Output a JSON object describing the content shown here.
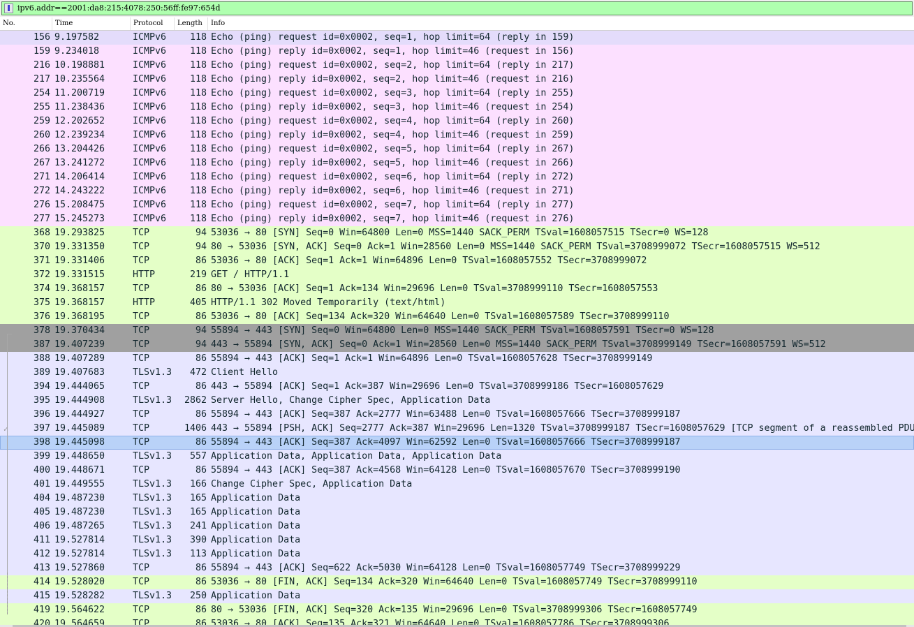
{
  "filter": {
    "value": "ipv6.addr==2001:da8:215:4078:250:56ff:fe97:654d"
  },
  "columns": {
    "no": "No.",
    "time": "Time",
    "protocol": "Protocol",
    "length": "Length",
    "info": "Info"
  },
  "colors": {
    "icmp": "#fce0ff",
    "icmp_first": "#e4dcfb",
    "tcp_http": "#e4ffc7",
    "tcp_syn": "#a0a0a0",
    "tcp_other": "#e7e6ff",
    "selected": "#b9d2f8"
  },
  "packets": [
    {
      "no": "156",
      "time": "9.197582",
      "proto": "ICMPv6",
      "len": "118",
      "info": "Echo (ping) request id=0x0002, seq=1, hop limit=64 (reply in 159)",
      "color": "icmp_first"
    },
    {
      "no": "159",
      "time": "9.234018",
      "proto": "ICMPv6",
      "len": "118",
      "info": "Echo (ping) reply id=0x0002, seq=1, hop limit=46 (request in 156)",
      "color": "icmp"
    },
    {
      "no": "216",
      "time": "10.198881",
      "proto": "ICMPv6",
      "len": "118",
      "info": "Echo (ping) request id=0x0002, seq=2, hop limit=64 (reply in 217)",
      "color": "icmp"
    },
    {
      "no": "217",
      "time": "10.235564",
      "proto": "ICMPv6",
      "len": "118",
      "info": "Echo (ping) reply id=0x0002, seq=2, hop limit=46 (request in 216)",
      "color": "icmp"
    },
    {
      "no": "254",
      "time": "11.200719",
      "proto": "ICMPv6",
      "len": "118",
      "info": "Echo (ping) request id=0x0002, seq=3, hop limit=64 (reply in 255)",
      "color": "icmp"
    },
    {
      "no": "255",
      "time": "11.238436",
      "proto": "ICMPv6",
      "len": "118",
      "info": "Echo (ping) reply id=0x0002, seq=3, hop limit=46 (request in 254)",
      "color": "icmp"
    },
    {
      "no": "259",
      "time": "12.202652",
      "proto": "ICMPv6",
      "len": "118",
      "info": "Echo (ping) request id=0x0002, seq=4, hop limit=64 (reply in 260)",
      "color": "icmp"
    },
    {
      "no": "260",
      "time": "12.239234",
      "proto": "ICMPv6",
      "len": "118",
      "info": "Echo (ping) reply id=0x0002, seq=4, hop limit=46 (request in 259)",
      "color": "icmp"
    },
    {
      "no": "266",
      "time": "13.204426",
      "proto": "ICMPv6",
      "len": "118",
      "info": "Echo (ping) request id=0x0002, seq=5, hop limit=64 (reply in 267)",
      "color": "icmp"
    },
    {
      "no": "267",
      "time": "13.241272",
      "proto": "ICMPv6",
      "len": "118",
      "info": "Echo (ping) reply id=0x0002, seq=5, hop limit=46 (request in 266)",
      "color": "icmp"
    },
    {
      "no": "271",
      "time": "14.206414",
      "proto": "ICMPv6",
      "len": "118",
      "info": "Echo (ping) request id=0x0002, seq=6, hop limit=64 (reply in 272)",
      "color": "icmp"
    },
    {
      "no": "272",
      "time": "14.243222",
      "proto": "ICMPv6",
      "len": "118",
      "info": "Echo (ping) reply id=0x0002, seq=6, hop limit=46 (request in 271)",
      "color": "icmp"
    },
    {
      "no": "276",
      "time": "15.208475",
      "proto": "ICMPv6",
      "len": "118",
      "info": "Echo (ping) request id=0x0002, seq=7, hop limit=64 (reply in 277)",
      "color": "icmp"
    },
    {
      "no": "277",
      "time": "15.245273",
      "proto": "ICMPv6",
      "len": "118",
      "info": "Echo (ping) reply id=0x0002, seq=7, hop limit=46 (request in 276)",
      "color": "icmp"
    },
    {
      "no": "368",
      "time": "19.293825",
      "proto": "TCP",
      "len": "94",
      "info": "53036 → 80 [SYN] Seq=0 Win=64800 Len=0 MSS=1440 SACK_PERM TSval=1608057515 TSecr=0 WS=128",
      "color": "tcp_http"
    },
    {
      "no": "370",
      "time": "19.331350",
      "proto": "TCP",
      "len": "94",
      "info": "80 → 53036 [SYN, ACK] Seq=0 Ack=1 Win=28560 Len=0 MSS=1440 SACK_PERM TSval=3708999072 TSecr=1608057515 WS=512",
      "color": "tcp_http"
    },
    {
      "no": "371",
      "time": "19.331406",
      "proto": "TCP",
      "len": "86",
      "info": "53036 → 80 [ACK] Seq=1 Ack=1 Win=64896 Len=0 TSval=1608057552 TSecr=3708999072",
      "color": "tcp_http"
    },
    {
      "no": "372",
      "time": "19.331515",
      "proto": "HTTP",
      "len": "219",
      "info": "GET / HTTP/1.1",
      "color": "tcp_http"
    },
    {
      "no": "374",
      "time": "19.368157",
      "proto": "TCP",
      "len": "86",
      "info": "80 → 53036 [ACK] Seq=1 Ack=134 Win=29696 Len=0 TSval=3708999110 TSecr=1608057553",
      "color": "tcp_http"
    },
    {
      "no": "375",
      "time": "19.368157",
      "proto": "HTTP",
      "len": "405",
      "info": "HTTP/1.1 302 Moved Temporarily  (text/html)",
      "color": "tcp_http"
    },
    {
      "no": "376",
      "time": "19.368195",
      "proto": "TCP",
      "len": "86",
      "info": "53036 → 80 [ACK] Seq=134 Ack=320 Win=64640 Len=0 TSval=1608057589 TSecr=3708999110",
      "color": "tcp_http"
    },
    {
      "no": "378",
      "time": "19.370434",
      "proto": "TCP",
      "len": "94",
      "info": "55894 → 443 [SYN] Seq=0 Win=64800 Len=0 MSS=1440 SACK_PERM TSval=1608057591 TSecr=0 WS=128",
      "color": "tcp_syn"
    },
    {
      "no": "387",
      "time": "19.407239",
      "proto": "TCP",
      "len": "94",
      "info": "443 → 55894 [SYN, ACK] Seq=0 Ack=1 Win=28560 Len=0 MSS=1440 SACK_PERM TSval=3708999149 TSecr=1608057591 WS=512",
      "color": "tcp_syn"
    },
    {
      "no": "388",
      "time": "19.407289",
      "proto": "TCP",
      "len": "86",
      "info": "55894 → 443 [ACK] Seq=1 Ack=1 Win=64896 Len=0 TSval=1608057628 TSecr=3708999149",
      "color": "tcp_other"
    },
    {
      "no": "389",
      "time": "19.407683",
      "proto": "TLSv1.3",
      "len": "472",
      "info": "Client Hello",
      "color": "tcp_other"
    },
    {
      "no": "394",
      "time": "19.444065",
      "proto": "TCP",
      "len": "86",
      "info": "443 → 55894 [ACK] Seq=1 Ack=387 Win=29696 Len=0 TSval=3708999186 TSecr=1608057629",
      "color": "tcp_other"
    },
    {
      "no": "395",
      "time": "19.444908",
      "proto": "TLSv1.3",
      "len": "2862",
      "info": "Server Hello, Change Cipher Spec, Application Data",
      "color": "tcp_other"
    },
    {
      "no": "396",
      "time": "19.444927",
      "proto": "TCP",
      "len": "86",
      "info": "55894 → 443 [ACK] Seq=387 Ack=2777 Win=63488 Len=0 TSval=1608057666 TSecr=3708999187",
      "color": "tcp_other"
    },
    {
      "no": "397",
      "time": "19.445089",
      "proto": "TCP",
      "len": "1406",
      "info": "443 → 55894 [PSH, ACK] Seq=2777 Ack=387 Win=29696 Len=1320 TSval=3708999187 TSecr=1608057629 [TCP segment of a reassembled PDU",
      "color": "tcp_other"
    },
    {
      "no": "398",
      "time": "19.445098",
      "proto": "TCP",
      "len": "86",
      "info": "55894 → 443 [ACK] Seq=387 Ack=4097 Win=62592 Len=0 TSval=1608057666 TSecr=3708999187",
      "color": "selected"
    },
    {
      "no": "399",
      "time": "19.448650",
      "proto": "TLSv1.3",
      "len": "557",
      "info": "Application Data, Application Data, Application Data",
      "color": "tcp_other"
    },
    {
      "no": "400",
      "time": "19.448671",
      "proto": "TCP",
      "len": "86",
      "info": "55894 → 443 [ACK] Seq=387 Ack=4568 Win=64128 Len=0 TSval=1608057670 TSecr=3708999190",
      "color": "tcp_other"
    },
    {
      "no": "401",
      "time": "19.449555",
      "proto": "TLSv1.3",
      "len": "166",
      "info": "Change Cipher Spec, Application Data",
      "color": "tcp_other"
    },
    {
      "no": "404",
      "time": "19.487230",
      "proto": "TLSv1.3",
      "len": "165",
      "info": "Application Data",
      "color": "tcp_other"
    },
    {
      "no": "405",
      "time": "19.487230",
      "proto": "TLSv1.3",
      "len": "165",
      "info": "Application Data",
      "color": "tcp_other"
    },
    {
      "no": "406",
      "time": "19.487265",
      "proto": "TLSv1.3",
      "len": "241",
      "info": "Application Data",
      "color": "tcp_other"
    },
    {
      "no": "411",
      "time": "19.527814",
      "proto": "TLSv1.3",
      "len": "390",
      "info": "Application Data",
      "color": "tcp_other"
    },
    {
      "no": "412",
      "time": "19.527814",
      "proto": "TLSv1.3",
      "len": "113",
      "info": "Application Data",
      "color": "tcp_other"
    },
    {
      "no": "413",
      "time": "19.527860",
      "proto": "TCP",
      "len": "86",
      "info": "55894 → 443 [ACK] Seq=622 Ack=5030 Win=64128 Len=0 TSval=1608057749 TSecr=3708999229",
      "color": "tcp_other"
    },
    {
      "no": "414",
      "time": "19.528020",
      "proto": "TCP",
      "len": "86",
      "info": "53036 → 80 [FIN, ACK] Seq=134 Ack=320 Win=64640 Len=0 TSval=1608057749 TSecr=3708999110",
      "color": "tcp_http"
    },
    {
      "no": "415",
      "time": "19.528282",
      "proto": "TLSv1.3",
      "len": "250",
      "info": "Application Data",
      "color": "tcp_other"
    },
    {
      "no": "419",
      "time": "19.564622",
      "proto": "TCP",
      "len": "86",
      "info": "80 → 53036 [FIN, ACK] Seq=320 Ack=135 Win=29696 Len=0 TSval=3708999306 TSecr=1608057749",
      "color": "tcp_http"
    },
    {
      "no": "420",
      "time": "19.564659",
      "proto": "TCP",
      "len": "86",
      "info": "53036 → 80 [ACK] Seq=135 Ack=321 Win=64640 Len=0 TSval=1608057786 TSecr=3708999306",
      "color": "tcp_http"
    }
  ]
}
